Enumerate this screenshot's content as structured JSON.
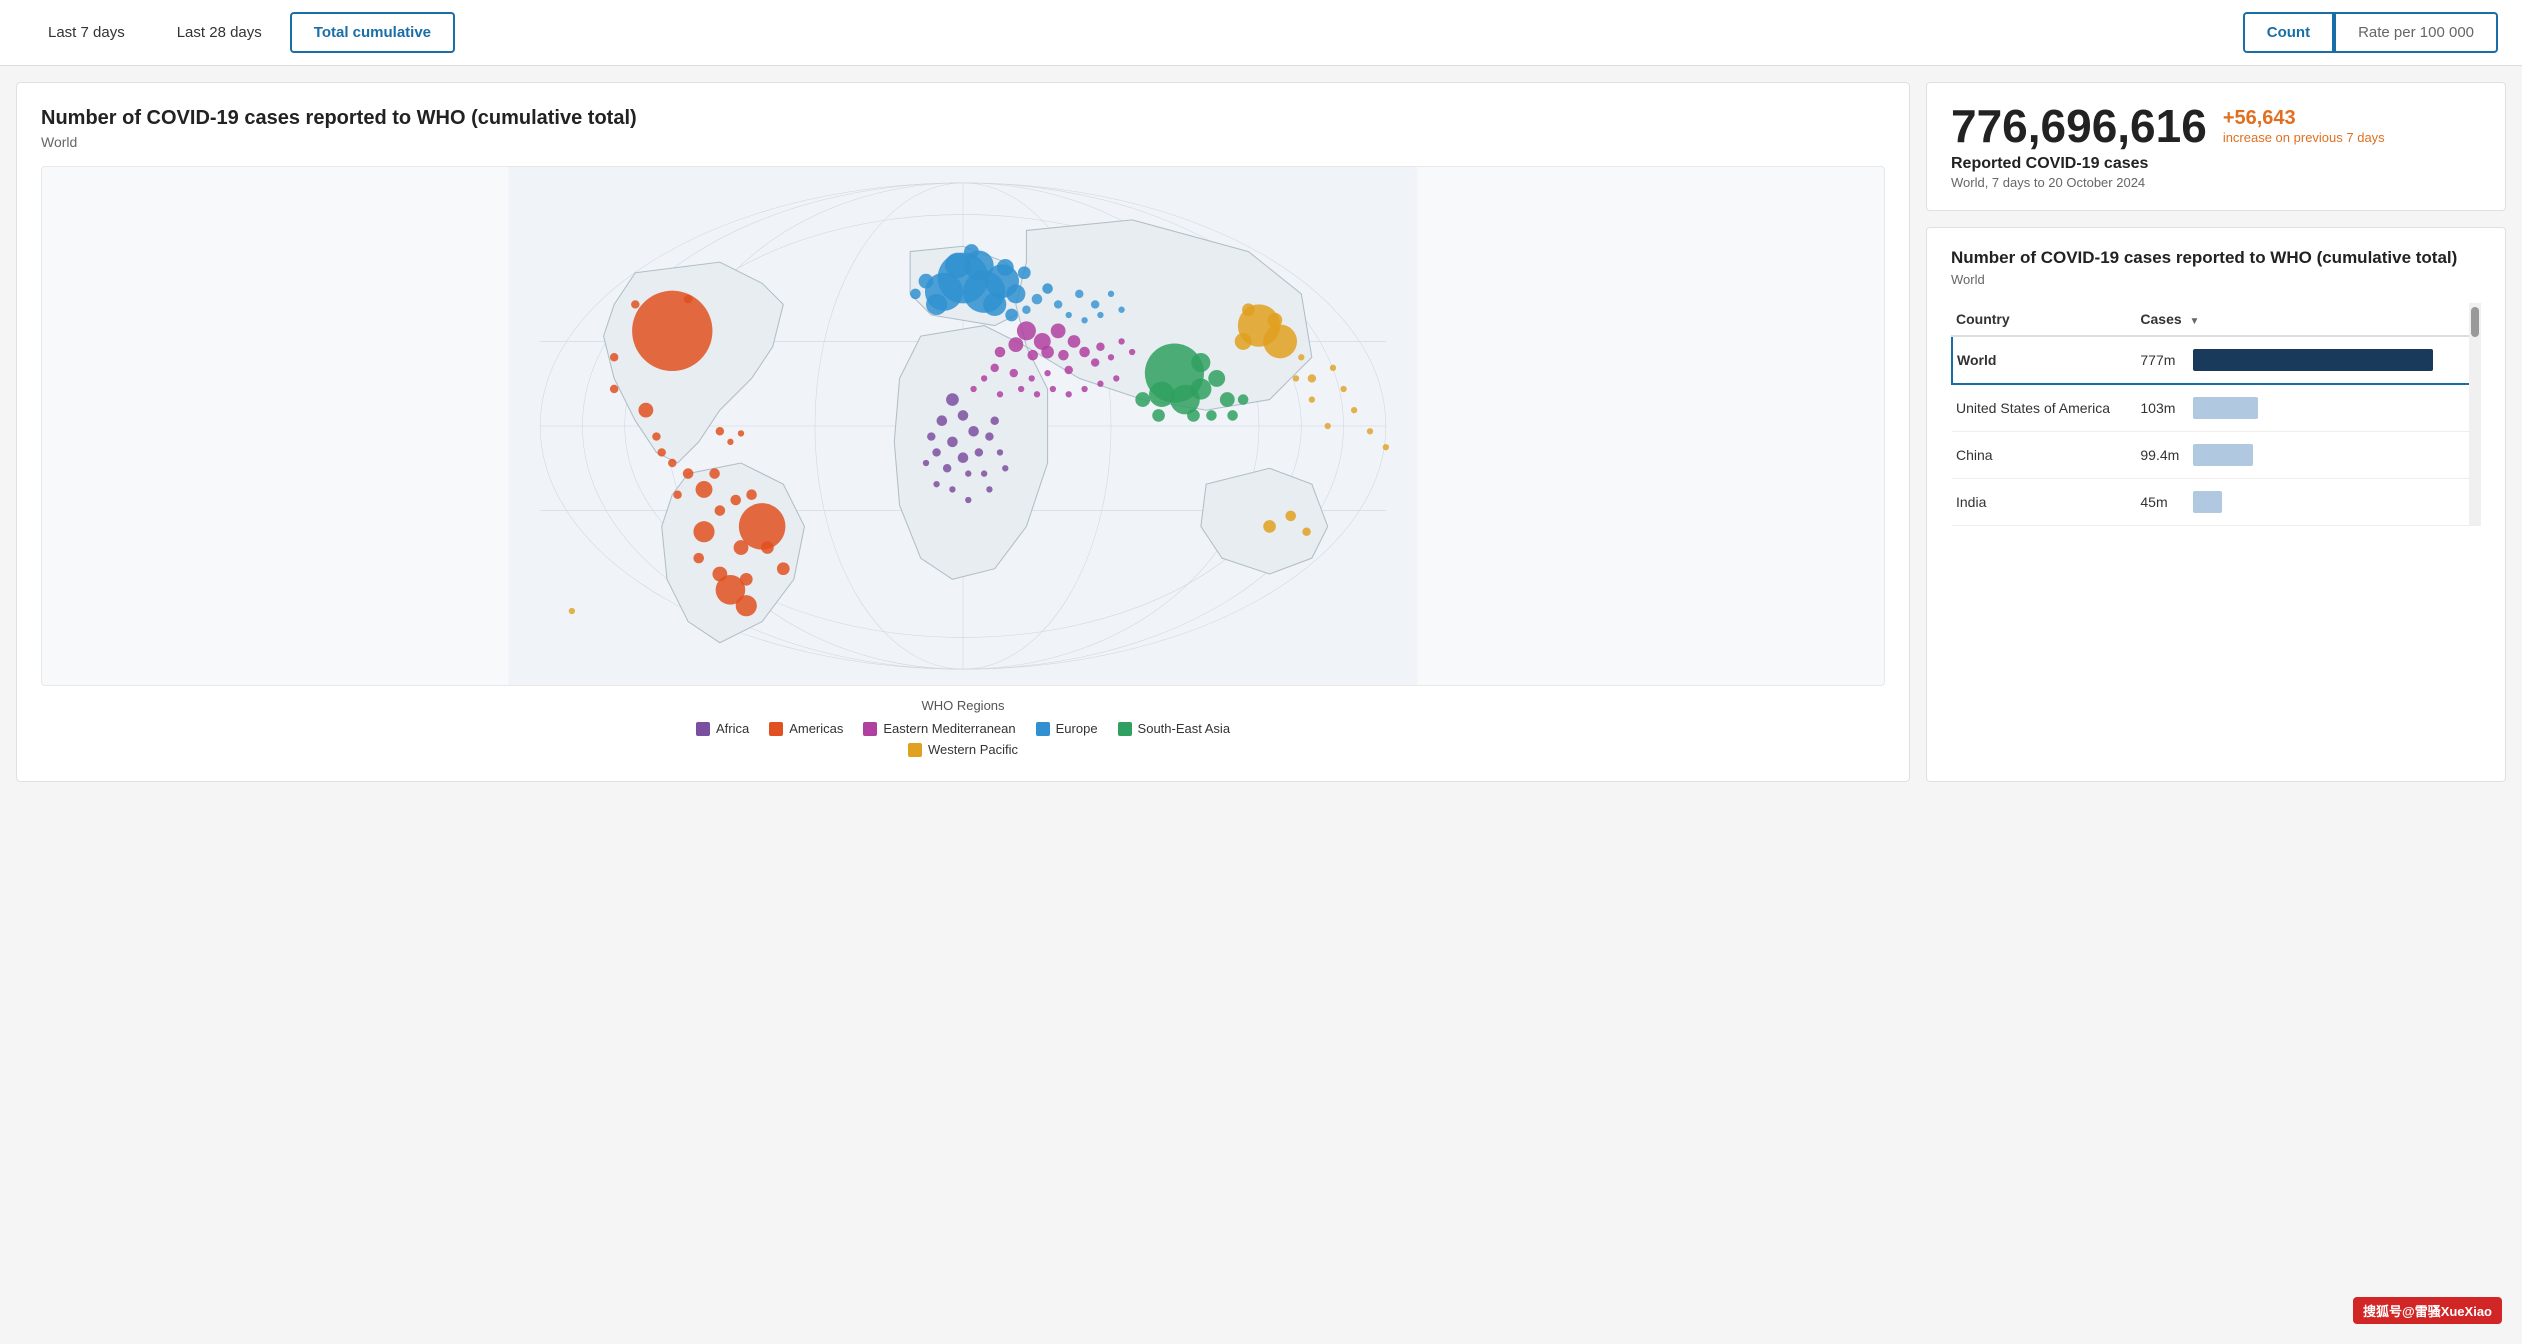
{
  "tabs": [
    {
      "id": "last7",
      "label": "Last 7 days",
      "active": false
    },
    {
      "id": "last28",
      "label": "Last 28 days",
      "active": false
    },
    {
      "id": "total",
      "label": "Total cumulative",
      "active": true
    }
  ],
  "toggle": {
    "count": "Count",
    "rate": "Rate per 100 000",
    "active": "count"
  },
  "chart": {
    "title": "Number of COVID-19 cases reported to WHO (cumulative total)",
    "subtitle": "World"
  },
  "stat": {
    "number": "776,696,616",
    "change": "+56,643",
    "change_label": "increase on previous 7 days",
    "desc": "Reported COVID-19 cases",
    "sub": "World, 7 days to 20 October 2024"
  },
  "table": {
    "title": "Number of COVID-19 cases reported to WHO (cumulative total)",
    "subtitle": "World",
    "col_country": "Country",
    "col_cases": "Cases",
    "rows": [
      {
        "country": "World",
        "cases": "777m",
        "bar_pct": 100,
        "bar_type": "dark",
        "selected": true
      },
      {
        "country": "United States of America",
        "cases": "103m",
        "bar_pct": 27,
        "bar_type": "light",
        "selected": false
      },
      {
        "country": "China",
        "cases": "99.4m",
        "bar_pct": 25,
        "bar_type": "light",
        "selected": false
      },
      {
        "country": "India",
        "cases": "45m",
        "bar_pct": 12,
        "bar_type": "light",
        "selected": false
      }
    ]
  },
  "legend": {
    "title": "WHO Regions",
    "items": [
      {
        "label": "Africa",
        "color": "#7b4fa0"
      },
      {
        "label": "Americas",
        "color": "#e05020"
      },
      {
        "label": "Eastern Mediterranean",
        "color": "#b040a0"
      },
      {
        "label": "Europe",
        "color": "#3090d0"
      },
      {
        "label": "South-East Asia",
        "color": "#30a060"
      },
      {
        "label": "Western Pacific",
        "color": "#e0a020"
      }
    ]
  },
  "watermark": "搜狐号@雷骚XueXiao"
}
